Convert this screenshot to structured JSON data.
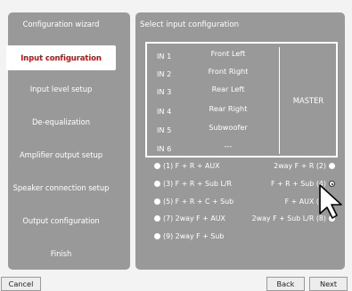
{
  "sidebar": {
    "items": [
      {
        "label": "Configuration wizard"
      },
      {
        "label": "Input configuration",
        "active": true
      },
      {
        "label": "Input level setup"
      },
      {
        "label": "De-equalization"
      },
      {
        "label": "Amplifier output setup"
      },
      {
        "label": "Speaker connection setup"
      },
      {
        "label": "Output configuration"
      },
      {
        "label": "Finish"
      }
    ]
  },
  "main": {
    "title": "Select input configuration",
    "inputs": [
      {
        "label": "IN 1",
        "value": "Front Left"
      },
      {
        "label": "IN 2",
        "value": "Front Right"
      },
      {
        "label": "IN 3",
        "value": "Rear Left"
      },
      {
        "label": "IN 4",
        "value": "Rear Right"
      },
      {
        "label": "IN 5",
        "value": "Subwoofer"
      },
      {
        "label": "IN 6",
        "value": "---"
      }
    ],
    "master_label": "MASTER",
    "options": [
      {
        "label": "(1) F + R + AUX",
        "checked": false
      },
      {
        "label": "2way F + R (2)",
        "checked": false
      },
      {
        "label": "(3) F + R + Sub L/R",
        "checked": false
      },
      {
        "label": "F + R + Sub (4)",
        "checked": true
      },
      {
        "label": "(5) F + R + C + Sub",
        "checked": false
      },
      {
        "label": "F + AUX (6)",
        "checked": false
      },
      {
        "label": "(7) 2way F + AUX",
        "checked": false
      },
      {
        "label": "2way F + Sub L/R (8)",
        "checked": false
      },
      {
        "label": "(9) 2way F + Sub",
        "checked": false
      }
    ]
  },
  "footer": {
    "cancel_label": "Cancel",
    "back_label": "Back",
    "next_label": "Next"
  },
  "colors": {
    "panel": "#999999",
    "active_text": "#e60000",
    "text": "#ffffff"
  }
}
